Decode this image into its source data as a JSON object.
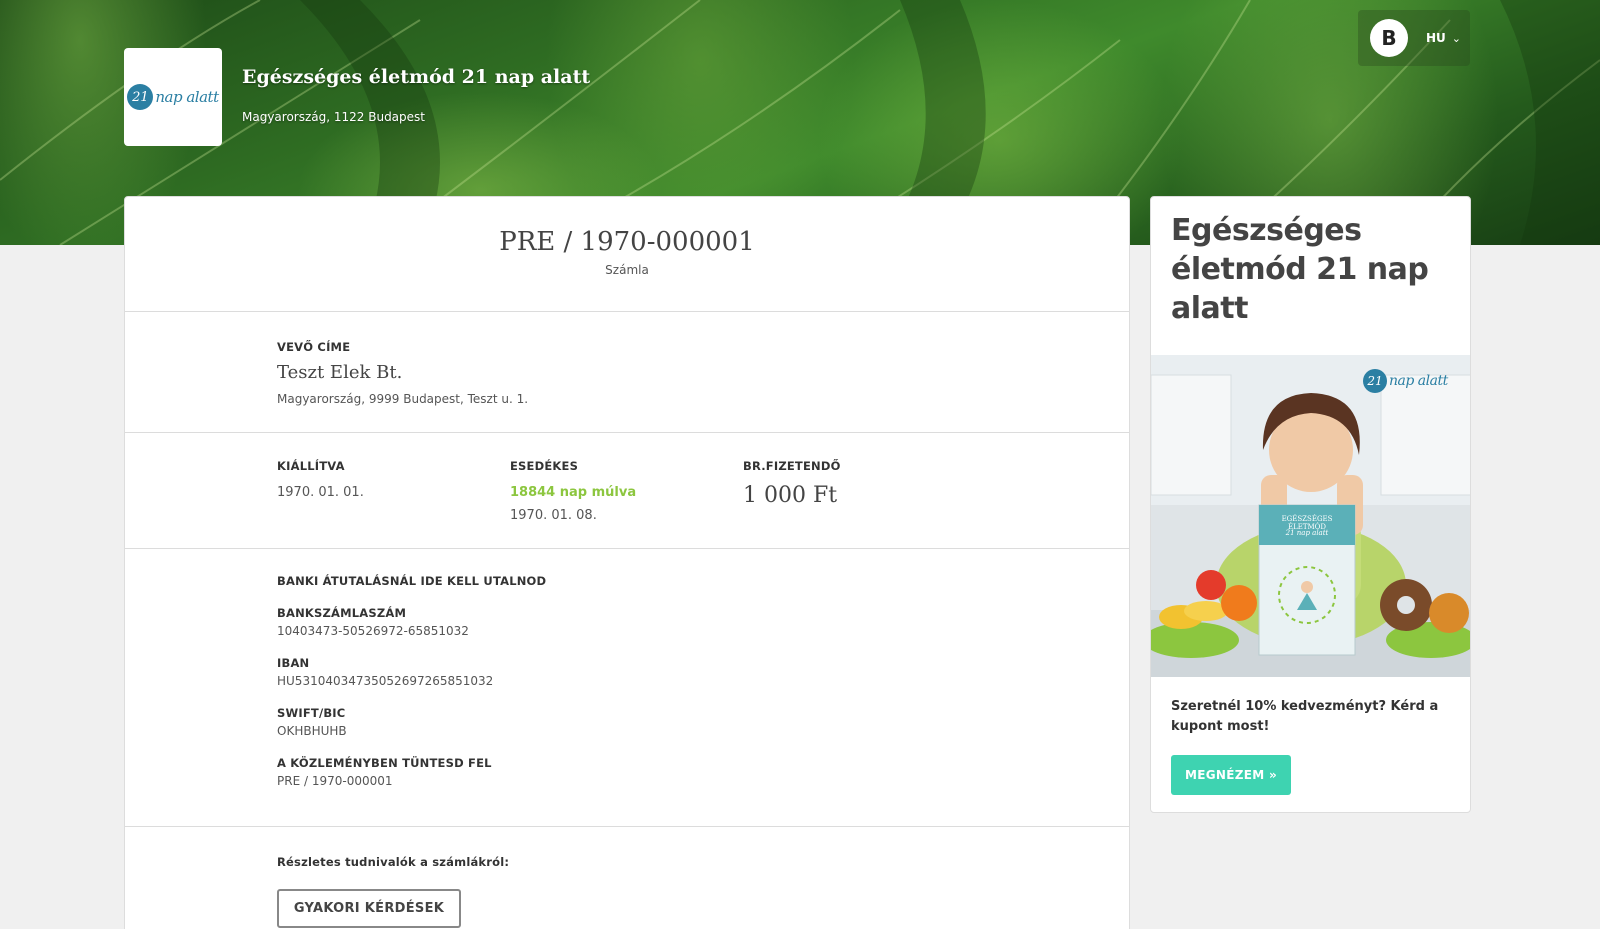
{
  "header": {
    "logo_number": "21",
    "logo_text": "nap alatt",
    "company_name": "Egészséges életmód 21 nap alatt",
    "company_address": "Magyarország, 1122 Budapest",
    "brand_icon_glyph": "B",
    "language": "HU"
  },
  "invoice": {
    "number": "PRE / 1970-000001",
    "type": "Számla",
    "buyer": {
      "label": "VEVŐ CÍME",
      "name": "Teszt Elek Bt.",
      "address": "Magyarország, 9999 Budapest, Teszt u. 1."
    },
    "issued": {
      "label": "KIÁLLÍTVA",
      "date": "1970. 01. 01."
    },
    "due": {
      "label": "ESEDÉKES",
      "relative": "18844 nap múlva",
      "date": "1970. 01. 08."
    },
    "gross": {
      "label": "BR.FIZETENDŐ",
      "amount": "1 000 Ft"
    },
    "bank": {
      "heading": "BANKI ÁTUTALÁSNÁL IDE KELL UTALNOD",
      "account_label": "BANKSZÁMLASZÁM",
      "account": "10403473-50526972-65851032",
      "iban_label": "IBAN",
      "iban": "HU53104034735052697265851032",
      "swift_label": "SWIFT/BIC",
      "swift": "OKHBHUHB",
      "reference_label": "A KÖZLEMÉNYBEN TÜNTESD FEL",
      "reference": "PRE / 1970-000001"
    },
    "faq": {
      "label": "Részletes tudnivalók a számlákról:",
      "button": "GYAKORI KÉRDÉSEK"
    }
  },
  "promo": {
    "title": "Egészséges életmód 21 nap alatt",
    "image_logo_number": "21",
    "image_logo_text": "nap alatt",
    "book_title": "EGÉSZSÉGES ÉLETMÓD",
    "book_subtitle": "21 nap alatt",
    "text": "Szeretnél 10% kedvezményt? Kérd a kupont most!",
    "button": "MEGNÉZEM »"
  },
  "colors": {
    "accent_green": "#8cc63f",
    "promo_button": "#3ed3b1",
    "logo_blue": "#2b7fa3"
  }
}
